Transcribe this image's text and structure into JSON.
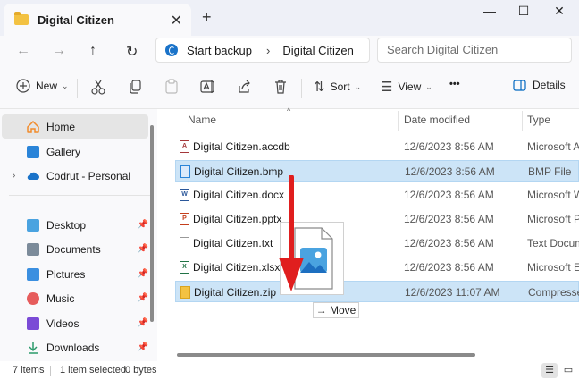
{
  "tab": {
    "title": "Digital Citizen",
    "close_glyph": "✕",
    "new_glyph": "+"
  },
  "window": {
    "minimize": "—",
    "maximize": "☐",
    "close": "✕"
  },
  "nav": {
    "back": "←",
    "forward": "→",
    "up": "↑",
    "refresh": "↻"
  },
  "address": {
    "root": "Start backup",
    "chevron": "›",
    "current": "Digital Citizen"
  },
  "search": {
    "placeholder": "Search Digital Citizen"
  },
  "toolbar": {
    "new_label": "New",
    "sort_label": "Sort",
    "view_label": "View",
    "more_glyph": "•••",
    "details_label": "Details"
  },
  "sidebar": {
    "items": [
      {
        "label": "Home",
        "icon": "home-icon",
        "color": "#f28b2b"
      },
      {
        "label": "Gallery",
        "icon": "gallery-icon",
        "color": "#2a84d8"
      },
      {
        "label": "Codrut - Personal",
        "icon": "cloud-icon",
        "color": "#1a73c9"
      },
      {
        "label": "Desktop",
        "icon": "desktop-icon",
        "color": "#4aa3e0"
      },
      {
        "label": "Documents",
        "icon": "documents-icon",
        "color": "#7c8b9a"
      },
      {
        "label": "Pictures",
        "icon": "pictures-icon",
        "color": "#3b8fe0"
      },
      {
        "label": "Music",
        "icon": "music-icon",
        "color": "#e65c5c"
      },
      {
        "label": "Videos",
        "icon": "videos-icon",
        "color": "#7b4bd6"
      },
      {
        "label": "Downloads",
        "icon": "downloads-icon",
        "color": "#2b9a6b"
      }
    ]
  },
  "columns": {
    "name": "Name",
    "date": "Date modified",
    "type": "Type"
  },
  "files": [
    {
      "name": "Digital Citizen.accdb",
      "date": "12/6/2023 8:56 AM",
      "type": "Microsoft Ac",
      "icon_color": "#a4373a",
      "icon_letter": "A"
    },
    {
      "name": "Digital Citizen.bmp",
      "date": "12/6/2023 8:56 AM",
      "type": "BMP File",
      "icon_color": "#2a84d8",
      "icon_letter": ""
    },
    {
      "name": "Digital Citizen.docx",
      "date": "12/6/2023 8:56 AM",
      "type": "Microsoft Wo",
      "icon_color": "#2b579a",
      "icon_letter": "W"
    },
    {
      "name": "Digital Citizen.pptx",
      "date": "12/6/2023 8:56 AM",
      "type": "Microsoft Po",
      "icon_color": "#c43e1c",
      "icon_letter": "P"
    },
    {
      "name": "Digital Citizen.txt",
      "date": "12/6/2023 8:56 AM",
      "type": "Text Docume",
      "icon_color": "#777777",
      "icon_letter": ""
    },
    {
      "name": "Digital Citizen.xlsx",
      "date": "12/6/2023 8:56 AM",
      "type": "Microsoft Exc",
      "icon_color": "#217346",
      "icon_letter": "X"
    },
    {
      "name": "Digital Citizen.zip",
      "date": "12/6/2023 11:07 AM",
      "type": "Compressed",
      "icon_color": "#e8b631",
      "icon_letter": ""
    }
  ],
  "drag": {
    "tooltip": "Move",
    "tooltip_glyph": "→"
  },
  "status": {
    "items": "7 items",
    "selected": "1 item selected",
    "size": "0 bytes"
  },
  "colors": {
    "accent": "#0067c0",
    "selection": "#cce4f7",
    "arrow": "#e01e1e"
  }
}
